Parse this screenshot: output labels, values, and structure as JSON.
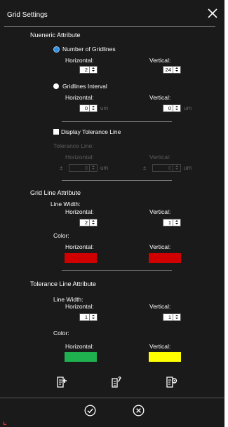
{
  "window": {
    "title": "Grid Settings"
  },
  "numeric": {
    "section_title": "Nueneric Attribute",
    "option_count_label": "Number of Gridlines",
    "option_interval_label": "Gridlines Interval",
    "horizontal_label": "Horizontal:",
    "vertical_label": "Vertical:",
    "count_horizontal": "2",
    "count_vertical": "24",
    "interval_horizontal": "0",
    "interval_vertical": "0",
    "unit": "um",
    "selected_option": "Number of Gridlines"
  },
  "tolerance": {
    "checkbox_label": "Display Tolerance Line",
    "checked": false,
    "line_label": "Tolerance Line:",
    "horizontal_label": "Horizontal:",
    "vertical_label": "Vertical:",
    "prefix": "±",
    "horizontal_value": "0",
    "vertical_value": "0",
    "unit": "um"
  },
  "grid_line": {
    "section_title": "Grid Line Attribute",
    "line_width_label": "Line Width:",
    "horizontal_label": "Horizontal:",
    "vertical_label": "Vertical:",
    "width_horizontal": "2",
    "width_vertical": "1",
    "color_label": "Color:",
    "color_horizontal_label": "Horizontal:",
    "color_vertical_label": "Vertical:",
    "color_horizontal": "#d00000",
    "color_vertical": "#d00000"
  },
  "tolerance_line": {
    "section_title": "Tolerance Line Attribute",
    "line_width_label": "Line Width:",
    "horizontal_label": "Horizontal:",
    "vertical_label": "Vertical:",
    "width_horizontal": "1",
    "width_vertical": "1",
    "color_label": "Color:",
    "color_horizontal_label": "Horizontal:",
    "color_vertical_label": "Vertical:",
    "color_horizontal": "#1fb050",
    "color_vertical": "#ffff00"
  },
  "toolbar": {
    "icons": [
      "add-preset-icon",
      "load-preset-icon",
      "preset-settings-icon"
    ]
  },
  "footer": {
    "icons": [
      "confirm-icon",
      "cancel-icon"
    ]
  }
}
